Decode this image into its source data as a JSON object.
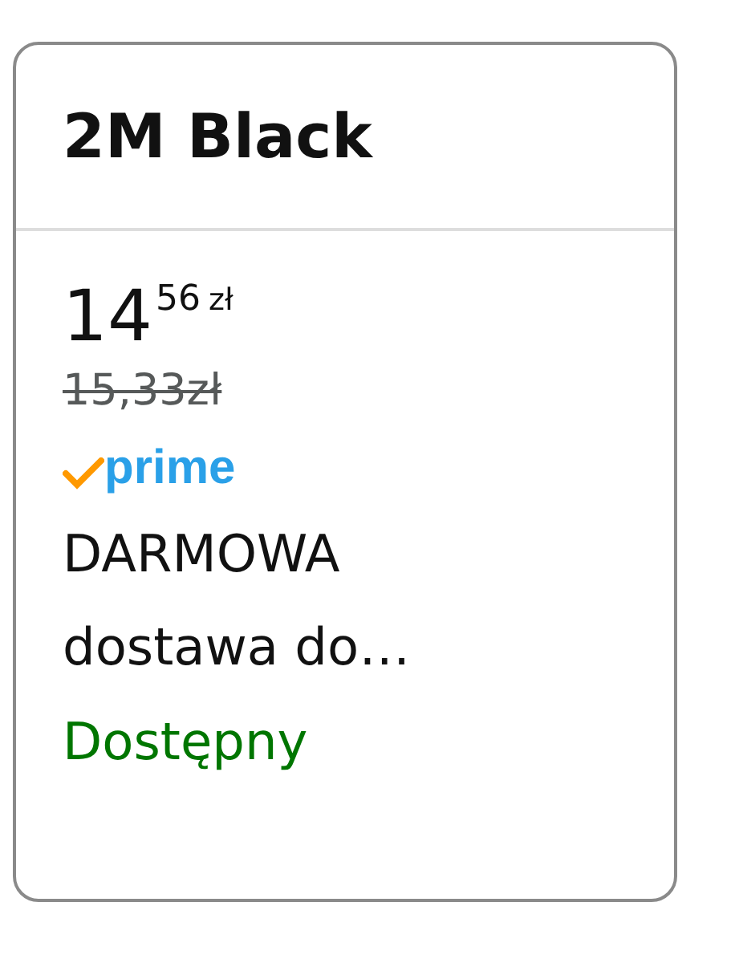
{
  "card": {
    "title": "2M Black",
    "price": {
      "whole": "14",
      "fraction": "56",
      "currency": "zł"
    },
    "list_price": "15,33zł",
    "badge": "prime",
    "delivery": "DARMOWA dostawa do…",
    "availability": "Dostępny"
  }
}
